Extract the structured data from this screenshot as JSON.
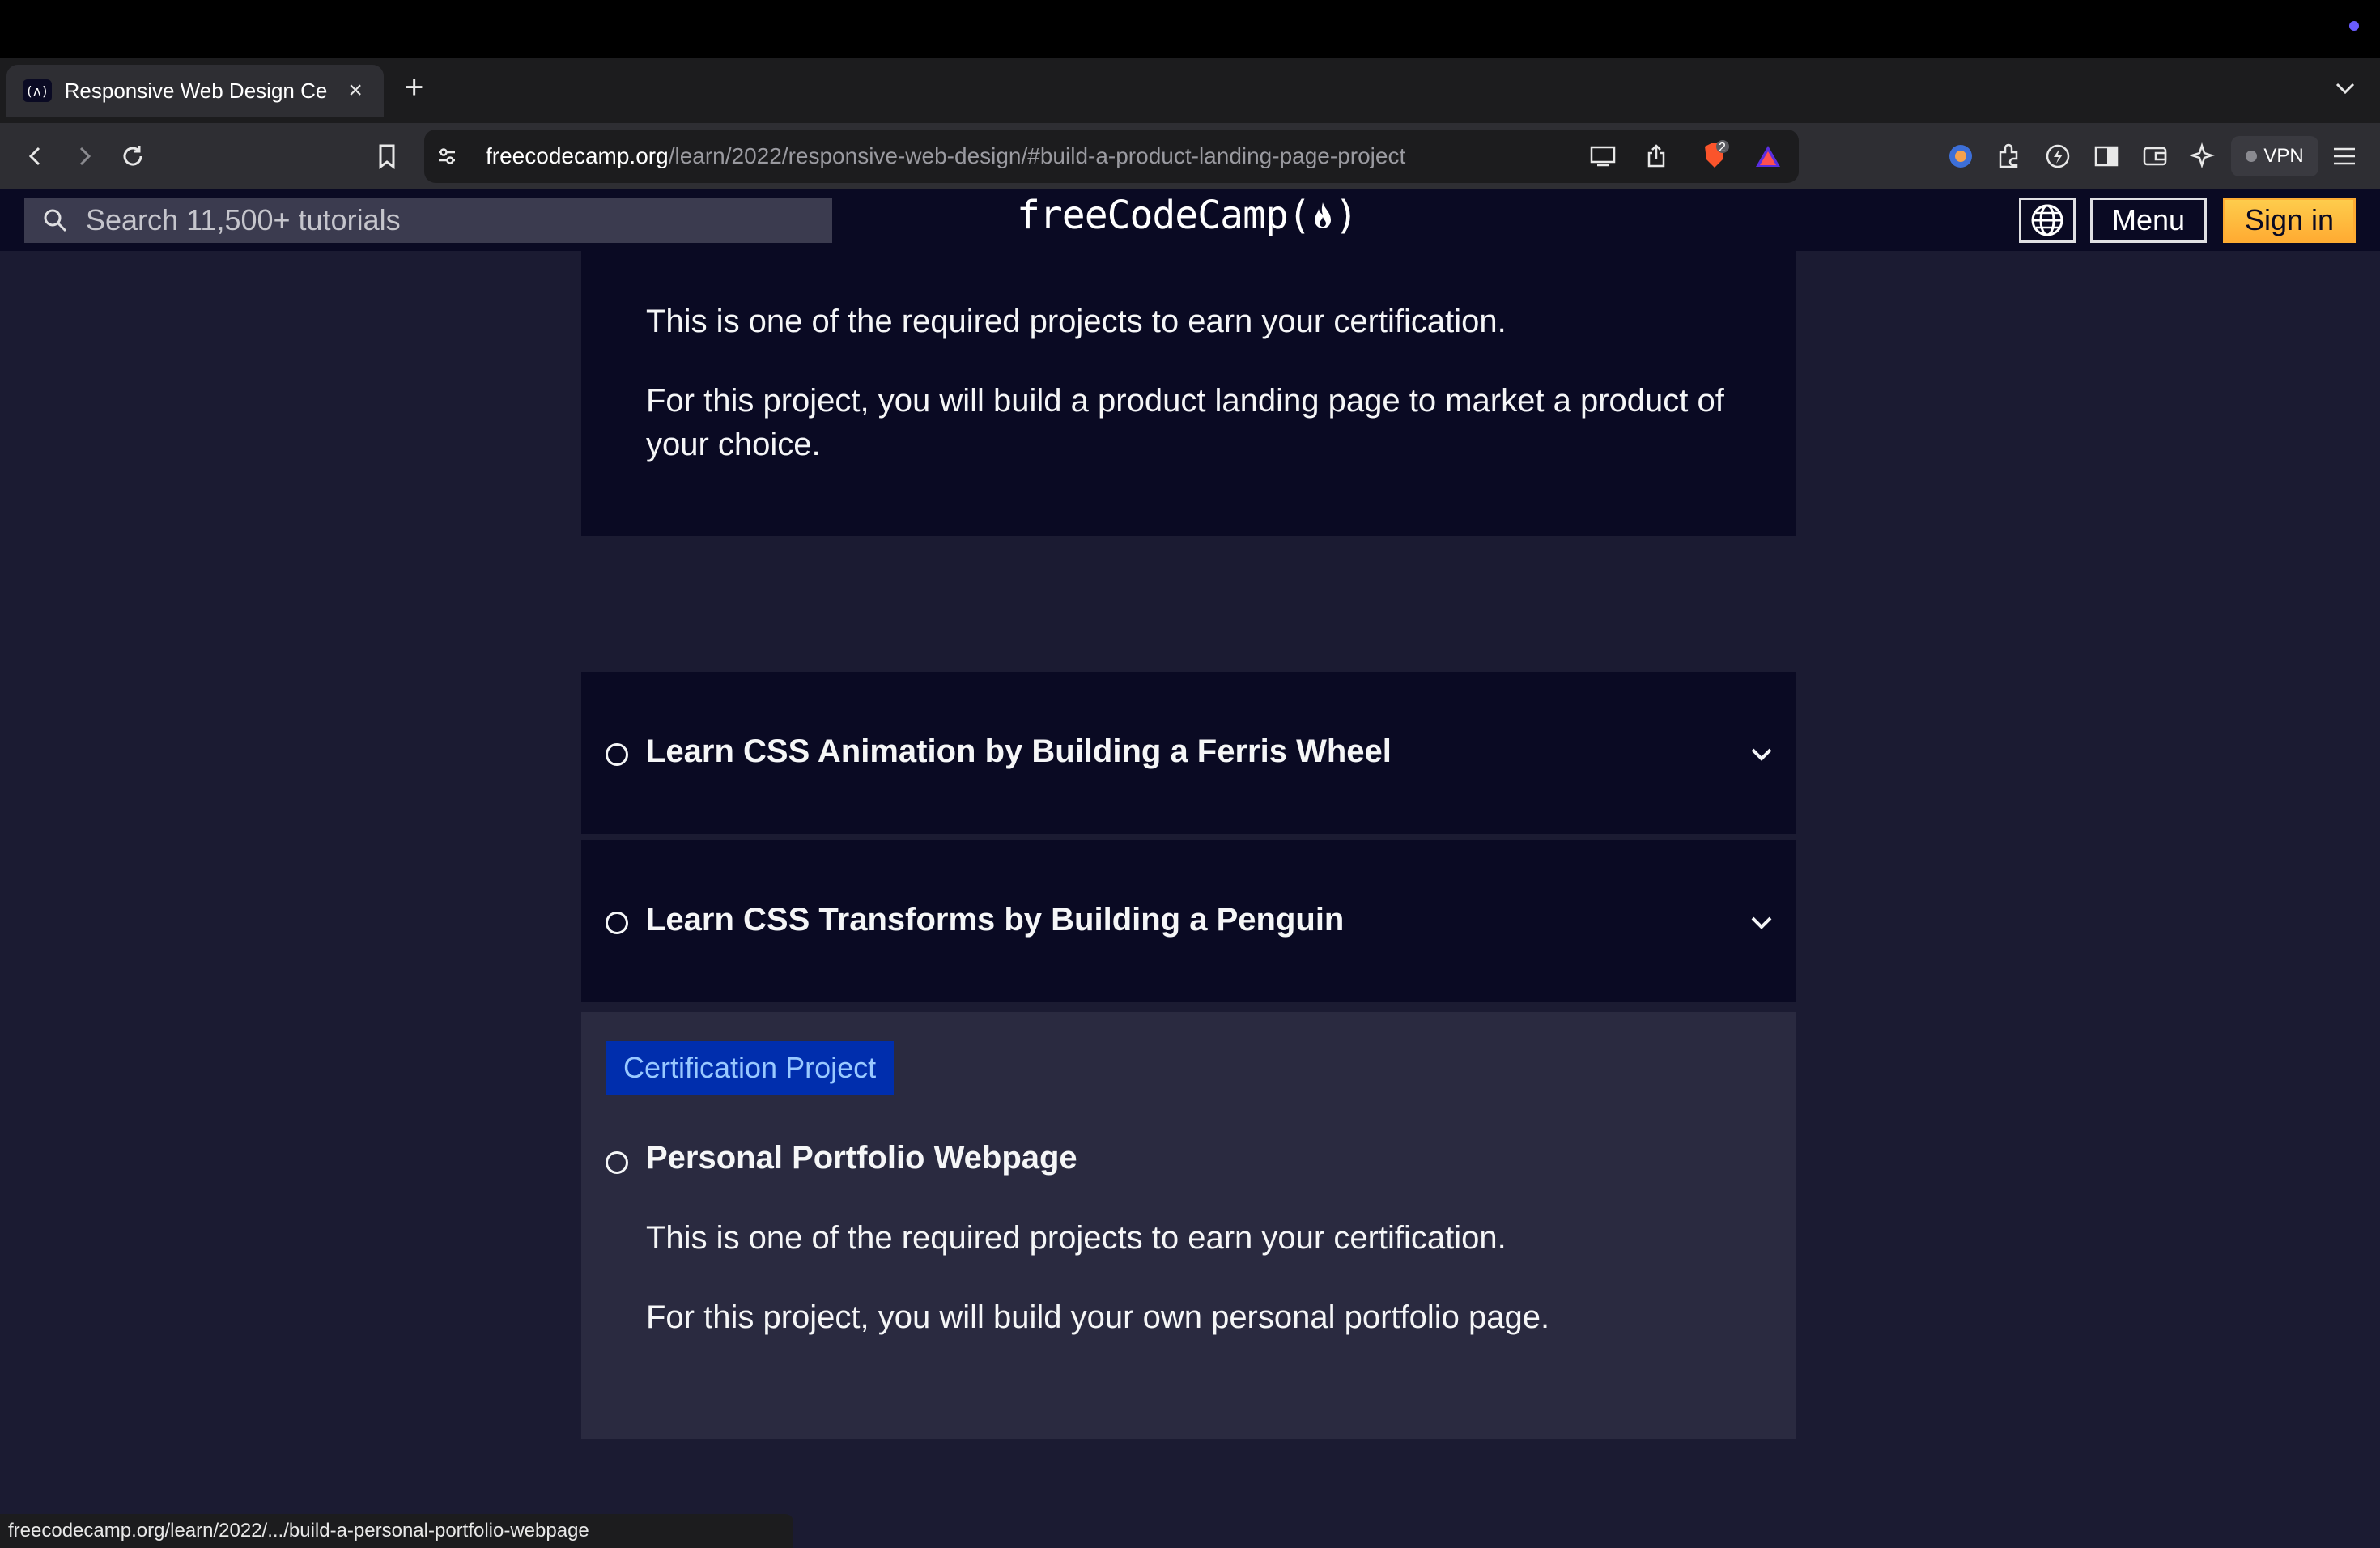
{
  "browser": {
    "tab": {
      "favicon_text": "(ʌ)",
      "title": "Responsive Web Design Certi"
    },
    "url": {
      "domain": "freecodecamp.org",
      "path": "/learn/2022/responsive-web-design/#build-a-product-landing-page-project"
    },
    "vpn_label": "VPN",
    "shield_badge": "2",
    "status_url": "freecodecamp.org/learn/2022/.../build-a-personal-portfolio-webpage"
  },
  "fcc_nav": {
    "search_placeholder": "Search 11,500+ tutorials",
    "logo": "freeCodeCamp(",
    "logo_end": ")",
    "menu_label": "Menu",
    "signin_label": "Sign in"
  },
  "top_project": {
    "desc1": "This is one of the required projects to earn your certification.",
    "desc2": "For this project, you will build a product landing page to market a product of your choice."
  },
  "blocks": [
    {
      "title": "Learn CSS Animation by Building a Ferris Wheel"
    },
    {
      "title": "Learn CSS Transforms by Building a Penguin"
    }
  ],
  "cert_project": {
    "badge": "Certification Project",
    "title": "Personal Portfolio Webpage",
    "desc1": "This is one of the required projects to earn your certification.",
    "desc2": "For this project, you will build your own personal portfolio page."
  },
  "colors": {
    "nav_bg": "#0a0a23",
    "page_bg": "#1b1b32",
    "signin": "#feac32",
    "badge_bg": "#002ead",
    "badge_text": "#99c9ff"
  }
}
